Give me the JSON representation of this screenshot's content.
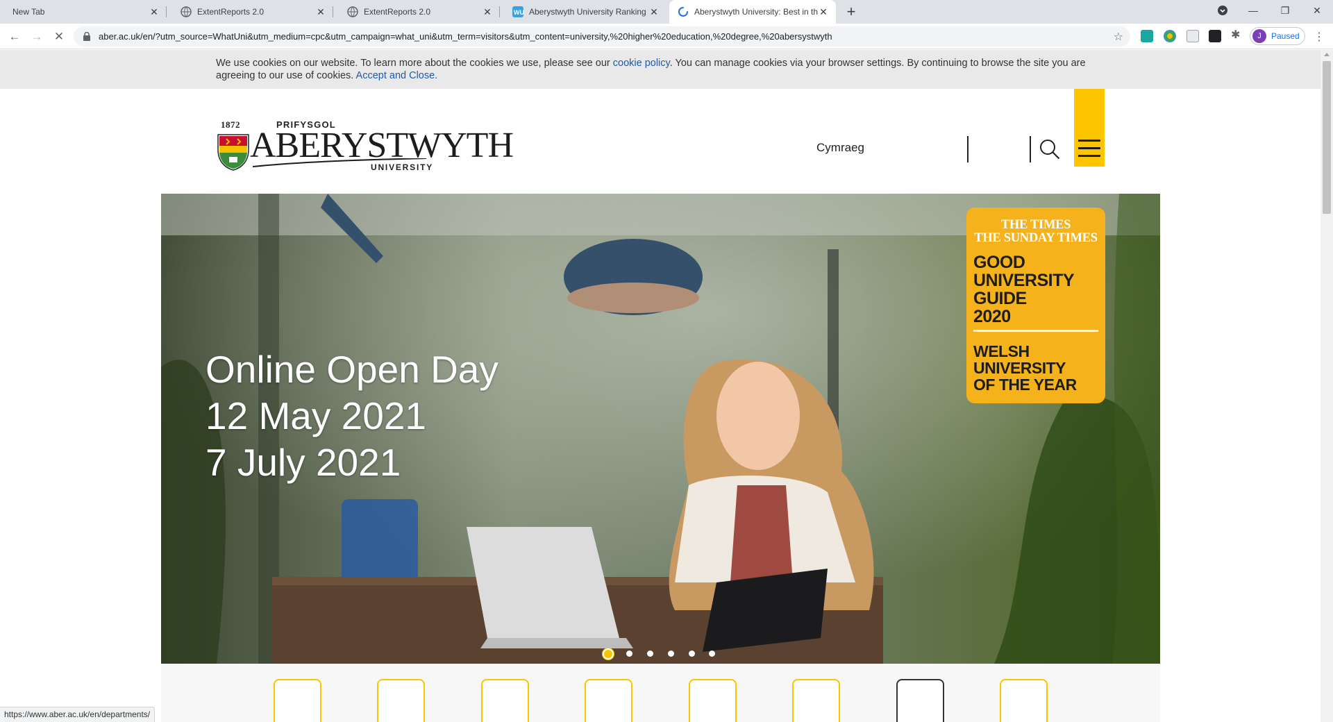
{
  "browser": {
    "tabs": [
      {
        "title": "New Tab",
        "active": false
      },
      {
        "title": "ExtentReports 2.0",
        "active": false
      },
      {
        "title": "ExtentReports 2.0",
        "active": false
      },
      {
        "title": "Aberystwyth University Ranking (",
        "active": false
      },
      {
        "title": "Aberystwyth University: Best in th",
        "active": true
      }
    ],
    "url": "aber.ac.uk/en/?utm_source=WhatUni&utm_medium=cpc&utm_campaign=what_uni&utm_term=visitors&utm_content=university,%20higher%20education,%20degree,%20abersystwyth",
    "profile_initial": "J",
    "profile_status": "Paused",
    "status_url": "https://www.aber.ac.uk/en/departments/"
  },
  "cookie_banner": {
    "text_before": "We use cookies on our website. To learn more about the cookies we use, please see our ",
    "policy_link": "cookie policy",
    "text_after": ". You can manage cookies via your browser settings. By continuing to browse the site you are agreeing to our use of cookies. ",
    "accept_link": "Accept and Close."
  },
  "header": {
    "logo": {
      "year": "1872",
      "line1": "PRIFYSGOL",
      "line2": "ABERYSTWYTH",
      "line3": "UNIVERSITY"
    },
    "language_link": "Cymraeg"
  },
  "hero": {
    "lines": [
      "Online Open Day",
      "12 May 2021",
      "7 July 2021"
    ],
    "badge": {
      "masthead1": "THE TIMES",
      "masthead2": "THE SUNDAY TIMES",
      "guide": [
        "GOOD",
        "UNIVERSITY",
        "GUIDE",
        "2020"
      ],
      "award": [
        "WELSH",
        "UNIVERSITY",
        "OF THE YEAR"
      ]
    },
    "slide_count": 6,
    "active_slide": 1
  },
  "colors": {
    "brand_yellow": "#fcc500",
    "badge_yellow": "#f5b21b",
    "link_blue": "#1f5aa6"
  }
}
